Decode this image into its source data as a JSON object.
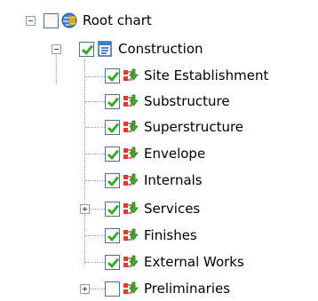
{
  "tree": {
    "root": {
      "label": "Root chart",
      "expanded": true,
      "checked": false,
      "icon": "globe-chart-icon"
    },
    "group": {
      "label": "Construction",
      "expanded": true,
      "checked": true,
      "icon": "chart-document-icon"
    },
    "items": [
      {
        "label": "Site Establishment",
        "checked": true,
        "icon": "task-arrow-icon",
        "expander": "none"
      },
      {
        "label": "Substructure",
        "checked": true,
        "icon": "task-arrow-icon",
        "expander": "none"
      },
      {
        "label": "Superstructure",
        "checked": true,
        "icon": "task-arrow-icon",
        "expander": "none"
      },
      {
        "label": "Envelope",
        "checked": true,
        "icon": "task-arrow-icon",
        "expander": "none"
      },
      {
        "label": "Internals",
        "checked": true,
        "icon": "task-arrow-icon",
        "expander": "none"
      },
      {
        "label": "Services",
        "checked": true,
        "icon": "task-arrow-icon",
        "expander": "plus"
      },
      {
        "label": "Finishes",
        "checked": true,
        "icon": "task-arrow-icon",
        "expander": "none"
      },
      {
        "label": "External Works",
        "checked": true,
        "icon": "task-arrow-icon",
        "expander": "none"
      },
      {
        "label": "Preliminaries",
        "checked": false,
        "icon": "task-arrow-icon",
        "expander": "plus"
      }
    ]
  }
}
